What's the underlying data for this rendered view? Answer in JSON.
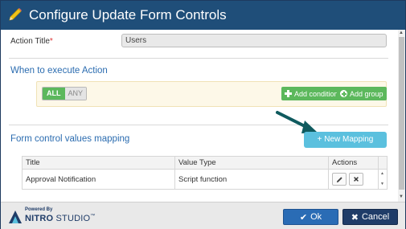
{
  "dialog": {
    "title": "Configure Update Form Controls"
  },
  "form": {
    "action_title_label": "Action Title",
    "required_mark": "*",
    "action_title_value": "Users"
  },
  "when_section": {
    "title": "When to execute Action",
    "toggle_all": "ALL",
    "toggle_any": "ANY",
    "add_condition": "Add condition",
    "add_group": "Add group"
  },
  "mapping_section": {
    "title": "Form control values mapping",
    "new_mapping_label": "+ New Mapping",
    "columns": [
      "Title",
      "Value Type",
      "Actions"
    ],
    "rows": [
      {
        "title": "Approval Notification",
        "value_type": "Script function"
      }
    ]
  },
  "footer": {
    "powered_by": "Powered By",
    "brand_bold": "NITRO",
    "brand_thin": " STUDIO",
    "trademark": "™",
    "ok_label": "Ok",
    "cancel_label": "Cancel"
  },
  "colors": {
    "titlebar": "#1f4e79",
    "section_title": "#2b6cb0",
    "green": "#5cb85c",
    "info": "#5bc0de",
    "ok": "#2a6cb5",
    "cancel": "#1f3c68"
  },
  "icons": {
    "title": "pencil-icon",
    "add_condition": "plus-icon",
    "add_group": "circle-plus-icon",
    "edit": "pencil-icon",
    "delete": "close-icon",
    "ok": "check-icon",
    "cancel": "x-icon",
    "callout": "arrow-icon"
  }
}
